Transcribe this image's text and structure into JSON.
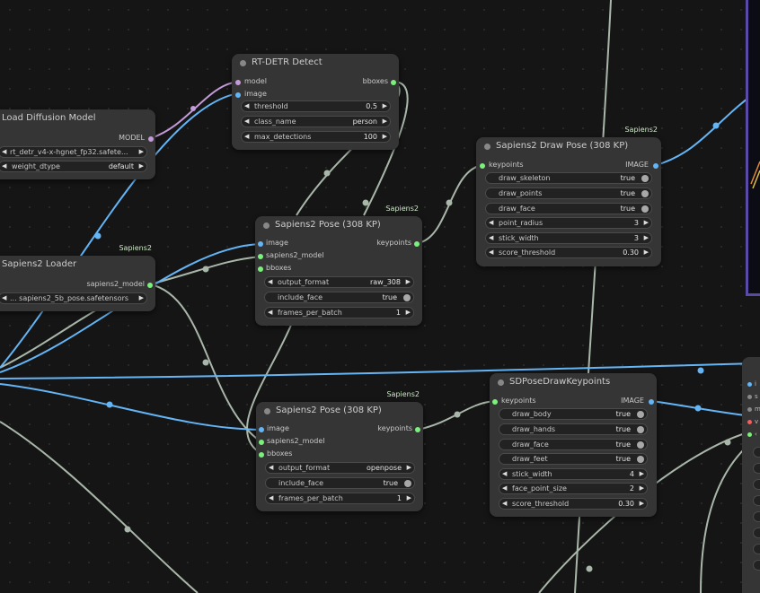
{
  "nodes": {
    "load_diffusion": {
      "title": "Load Diffusion Model",
      "output": "MODEL",
      "unet_name": "rt_detr_v4-x-hgnet_fp32.safete...",
      "weight_dtype_label": "weight_dtype",
      "weight_dtype": "default"
    },
    "rtdetr": {
      "title": "RT-DETR Detect",
      "inputs": [
        "model",
        "image"
      ],
      "output": "bboxes",
      "widgets": [
        {
          "label": "threshold",
          "value": "0.5"
        },
        {
          "label": "class_name",
          "value": "person"
        },
        {
          "label": "max_detections",
          "value": "100"
        }
      ]
    },
    "loader": {
      "title": "Sapiens2 Loader",
      "badge": "Sapiens2",
      "output": "sapiens2_model",
      "model_file": "... sapiens2_5b_pose.safetensors"
    },
    "pose1": {
      "title": "Sapiens2 Pose (308 KP)",
      "badge": "Sapiens2",
      "inputs": [
        "image",
        "sapiens2_model",
        "bboxes"
      ],
      "output": "keypoints",
      "widgets": [
        {
          "label": "output_format",
          "value": "raw_308"
        },
        {
          "label": "include_face",
          "value": "true"
        },
        {
          "label": "frames_per_batch",
          "value": "1"
        }
      ]
    },
    "pose2": {
      "title": "Sapiens2 Pose (308 KP)",
      "badge": "Sapiens2",
      "inputs": [
        "image",
        "sapiens2_model",
        "bboxes"
      ],
      "output": "keypoints",
      "widgets": [
        {
          "label": "output_format",
          "value": "openpose"
        },
        {
          "label": "include_face",
          "value": "true"
        },
        {
          "label": "frames_per_batch",
          "value": "1"
        }
      ]
    },
    "drawpose": {
      "title": "Sapiens2 Draw Pose (308 KP)",
      "badge": "Sapiens2",
      "input": "keypoints",
      "output": "IMAGE",
      "widgets": [
        {
          "label": "draw_skeleton",
          "value": "true"
        },
        {
          "label": "draw_points",
          "value": "true"
        },
        {
          "label": "draw_face",
          "value": "true"
        },
        {
          "label": "point_radius",
          "value": "3"
        },
        {
          "label": "stick_width",
          "value": "3"
        },
        {
          "label": "score_threshold",
          "value": "0.30"
        }
      ]
    },
    "sdpose": {
      "title": "SDPoseDrawKeypoints",
      "input": "keypoints",
      "output": "IMAGE",
      "widgets": [
        {
          "label": "draw_body",
          "value": "true"
        },
        {
          "label": "draw_hands",
          "value": "true"
        },
        {
          "label": "draw_face",
          "value": "true"
        },
        {
          "label": "draw_feet",
          "value": "true"
        },
        {
          "label": "stick_width",
          "value": "4"
        },
        {
          "label": "face_point_size",
          "value": "2"
        },
        {
          "label": "score_threshold",
          "value": "0.30"
        }
      ]
    }
  },
  "partial_node": {
    "labels": [
      "i",
      "s",
      "m",
      "v",
      "‹"
    ]
  },
  "colors": {
    "canvas": "#151515",
    "node": "#353535",
    "image_wire": "#64b5f6",
    "generic_wire": "#a9b7aa",
    "model_wire": "#c49ad8",
    "keypoints_socket": "#7cf07c",
    "panel_border": "#5a4aa8"
  }
}
